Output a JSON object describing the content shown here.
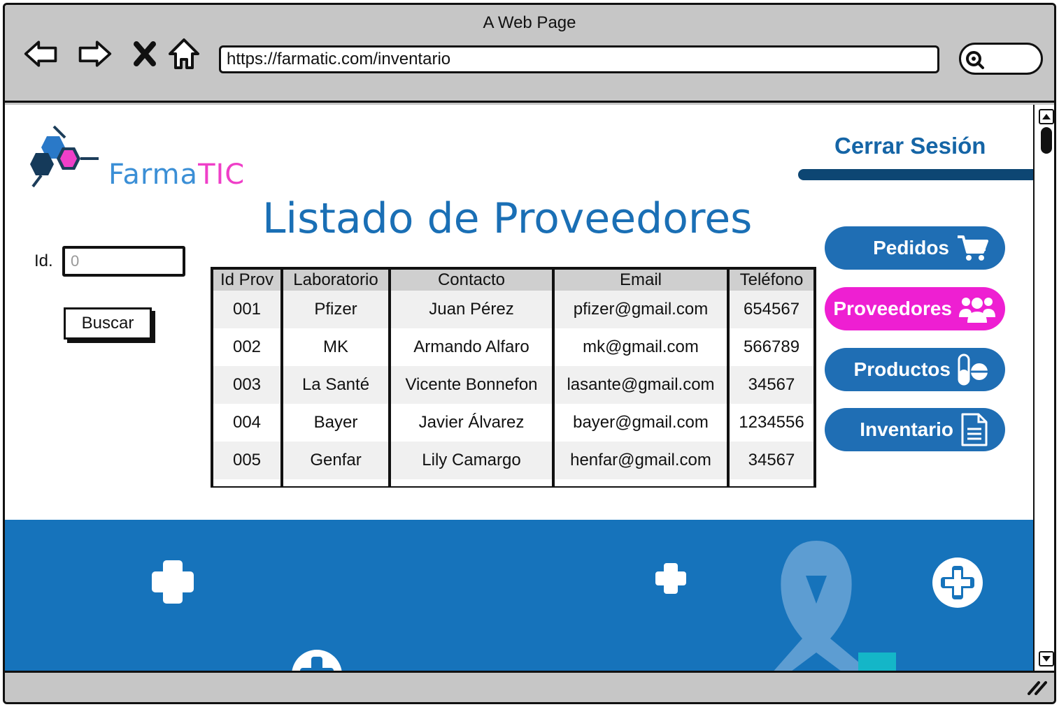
{
  "browser": {
    "window_title": "A Web Page",
    "url": "https://farmatic.com/inventario",
    "nav_icons": [
      "back-icon",
      "forward-icon",
      "stop-icon",
      "home-icon"
    ],
    "search_icon": "search-icon"
  },
  "header": {
    "logo_part1": "Farma",
    "logo_part2": "TIC",
    "logout_label": "Cerrar Sesión"
  },
  "page": {
    "title": "Listado de Proveedores"
  },
  "search": {
    "id_label": "Id.",
    "id_value": "0",
    "button_label": "Buscar"
  },
  "table": {
    "columns": [
      "Id Prov",
      "Laboratorio",
      "Contacto",
      "Email",
      "Teléfono"
    ],
    "rows": [
      [
        "001",
        "Pfizer",
        "Juan Pérez",
        "pfizer@gmail.com",
        "654567"
      ],
      [
        "002",
        "MK",
        "Armando Alfaro",
        "mk@gmail.com",
        "566789"
      ],
      [
        "003",
        "La Santé",
        "Vicente Bonnefon",
        "lasante@gmail.com",
        "34567"
      ],
      [
        "004",
        "Bayer",
        "Javier Álvarez",
        "bayer@gmail.com",
        "1234556"
      ],
      [
        "005",
        "Genfar",
        "Lily Camargo",
        "henfar@gmail.com",
        "34567"
      ]
    ]
  },
  "sidebar": {
    "items": [
      {
        "label": "Pedidos",
        "icon": "cart-icon",
        "color": "#1f6eb4"
      },
      {
        "label": "Proveedores",
        "icon": "users-icon",
        "color": "#ee1fd2"
      },
      {
        "label": "Productos",
        "icon": "pills-icon",
        "color": "#1f6eb4"
      },
      {
        "label": "Inventario",
        "icon": "document-icon",
        "color": "#1f6eb4"
      }
    ]
  },
  "colors": {
    "brand_blue": "#1a6fb5",
    "brand_pink": "#ee1fd2",
    "banner_blue": "#1673bb"
  }
}
